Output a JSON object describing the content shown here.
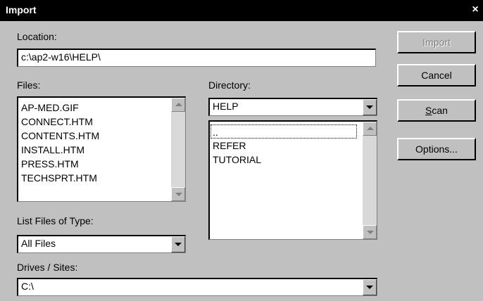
{
  "window": {
    "title": "Import",
    "close": "×"
  },
  "location": {
    "label": "Location:",
    "value": "c:\\ap2-w16\\HELP\\"
  },
  "files": {
    "label": "Files:",
    "items": [
      "AP-MED.GIF",
      "CONNECT.HTM",
      "CONTENTS.HTM",
      "INSTALL.HTM",
      "PRESS.HTM",
      "TECHSPRT.HTM"
    ]
  },
  "directory": {
    "label": "Directory:",
    "selected": "HELP",
    "items": [
      "..",
      "REFER",
      "TUTORIAL"
    ]
  },
  "file_type": {
    "label": "List Files of Type:",
    "selected": "All Files"
  },
  "drives": {
    "label": "Drives / Sites:",
    "selected": "C:\\"
  },
  "buttons": {
    "import": "Import",
    "cancel": "Cancel",
    "scan_mnemonic": "S",
    "scan_rest": "can",
    "options": "Options..."
  }
}
